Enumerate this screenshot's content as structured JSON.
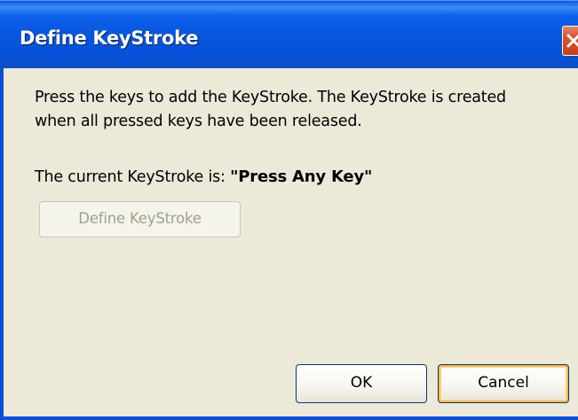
{
  "window": {
    "title": "Define KeyStroke",
    "close_icon": "close-icon"
  },
  "content": {
    "instructions": "Press the keys to add the KeyStroke. The KeyStroke is created when all pressed keys have been released.",
    "current_label": "The current KeyStroke is: ",
    "current_value": "\"Press Any Key\"",
    "define_button_label": "Define KeyStroke"
  },
  "footer": {
    "ok_label": "OK",
    "cancel_label": "Cancel"
  },
  "colors": {
    "titlebar": "#0756e0",
    "close_button": "#d9552f",
    "dialog_background": "#ece9d8",
    "default_button_focus": "#f8b84a"
  }
}
